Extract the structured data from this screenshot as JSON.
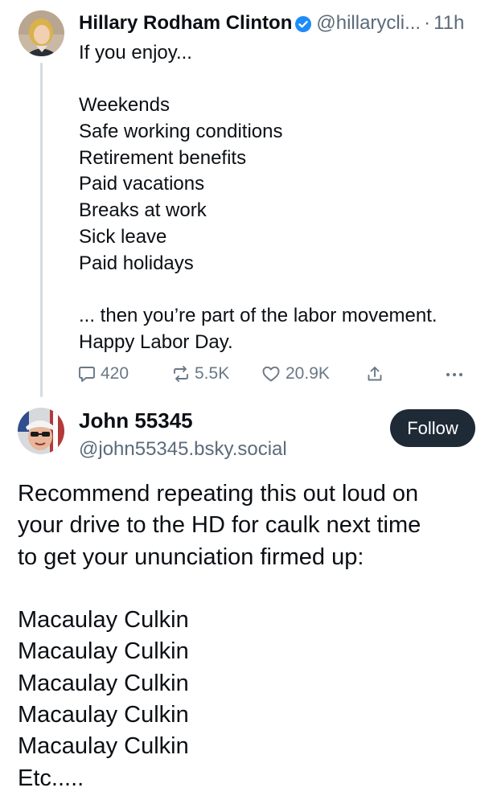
{
  "parent_post": {
    "author_name": "Hillary Rodham Clinton",
    "handle": "@hillarycli...",
    "separator": "·",
    "time": "11h",
    "body_lines": [
      "If you enjoy...",
      "",
      "Weekends",
      "Safe working conditions",
      "Retirement benefits",
      "Paid vacations",
      "Breaks at work",
      "Sick leave",
      "Paid holidays",
      "",
      "... then you’re part of the labor movement.",
      "Happy Labor Day."
    ],
    "actions": {
      "reply_count": "420",
      "repost_count": "5.5K",
      "like_count": "20.9K"
    }
  },
  "reply_post": {
    "author_name": "John 55345",
    "handle": "@john55345.bsky.social",
    "follow_label": "Follow",
    "body_lines": [
      "Recommend repeating this out loud on",
      "your drive to the HD for caulk next time",
      "to get your ununciation firmed up:",
      "",
      "Macaulay Culkin",
      "Macaulay Culkin",
      "Macaulay Culkin",
      "Macaulay Culkin",
      "Macaulay Culkin",
      "Etc....."
    ]
  },
  "colors": {
    "verified_badge": "#1d8cf8",
    "follow_button_bg": "#1e2a36",
    "secondary_text": "#5b6b7a",
    "thread_line": "#d4dbe2"
  },
  "icons": [
    "verified-badge-icon",
    "reply-icon",
    "repost-icon",
    "like-icon",
    "share-icon",
    "more-options-icon"
  ]
}
